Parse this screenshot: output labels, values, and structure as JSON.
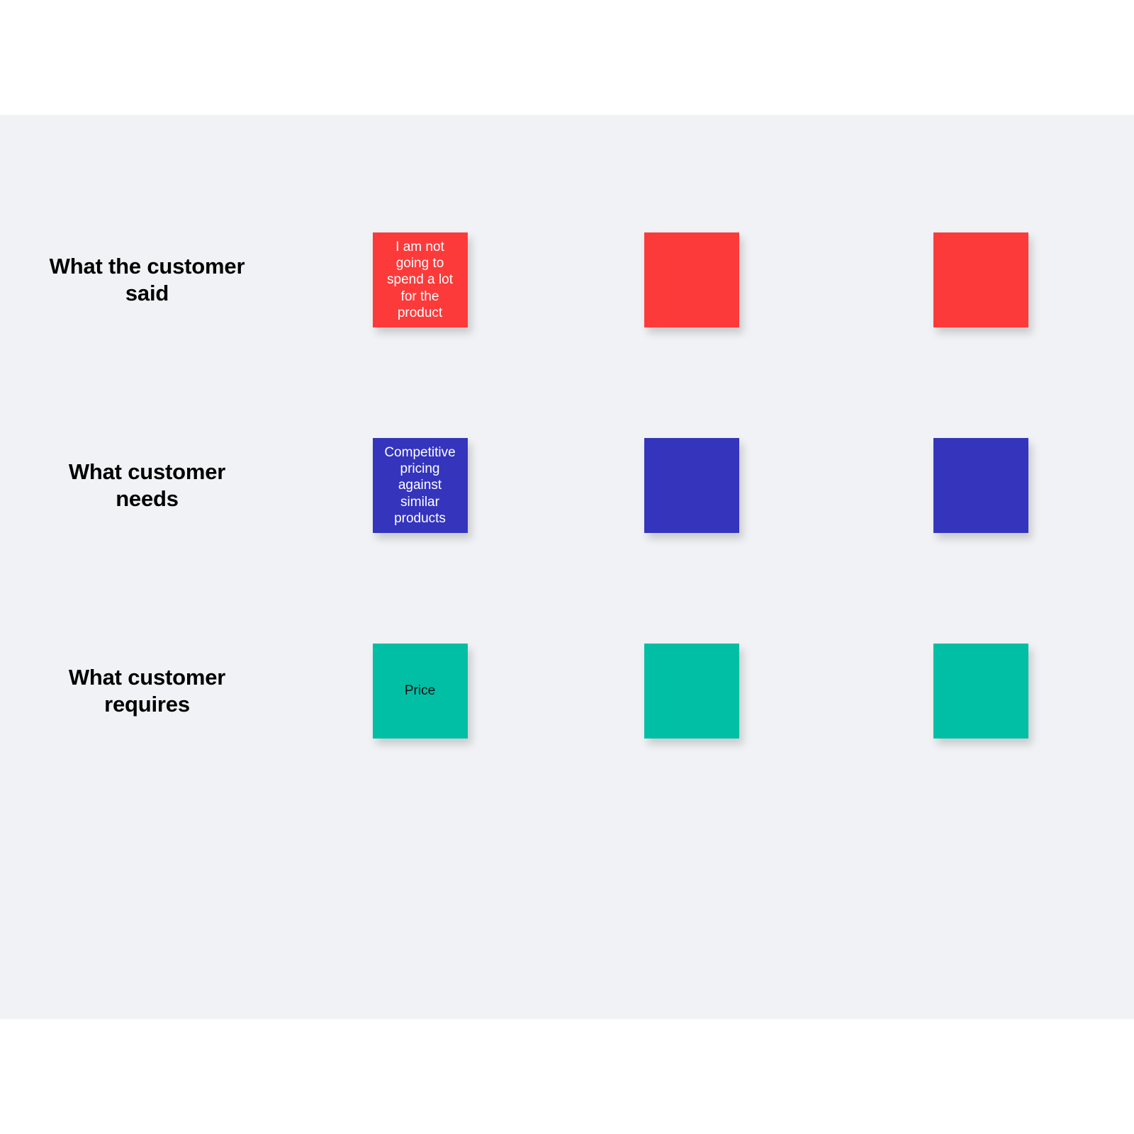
{
  "canvas": {
    "background_color": "#f0f2f5",
    "page_background_color": "#ffffff"
  },
  "board": {
    "title": "",
    "rows": [
      {
        "theme": "red",
        "header_label": "What the customer said",
        "header_bg": "#fd3a3a",
        "header_text_color": "#ffffff",
        "cell_bg": "#fd9090",
        "note_bg": "#fd3a3a",
        "note_text_color": "#ffffff",
        "notes": [
          {
            "text": "I am not going to spend a lot for the product",
            "empty": false
          },
          {
            "text": "",
            "empty": true
          },
          {
            "text": "",
            "empty": true
          }
        ]
      },
      {
        "theme": "blue",
        "header_label": "What customer needs",
        "header_bg": "#3b3ec6",
        "header_text_color": "#ffffff",
        "cell_bg": "#a6a6fb",
        "note_bg": "#3434bd",
        "note_text_color": "#ffffff",
        "notes": [
          {
            "text": "Competitive pricing against similar products",
            "empty": false
          },
          {
            "text": "",
            "empty": true
          },
          {
            "text": "",
            "empty": true
          }
        ]
      },
      {
        "theme": "teal",
        "header_label": "What customer requires",
        "header_bg": "#00bfa5",
        "header_text_color": "#1f2a2a",
        "cell_bg": "#b3f8e8",
        "note_bg": "#00bfa5",
        "note_text_color": "#111111",
        "notes": [
          {
            "text": "Price",
            "empty": false
          },
          {
            "text": "",
            "empty": true
          },
          {
            "text": "",
            "empty": true
          }
        ]
      }
    ]
  }
}
